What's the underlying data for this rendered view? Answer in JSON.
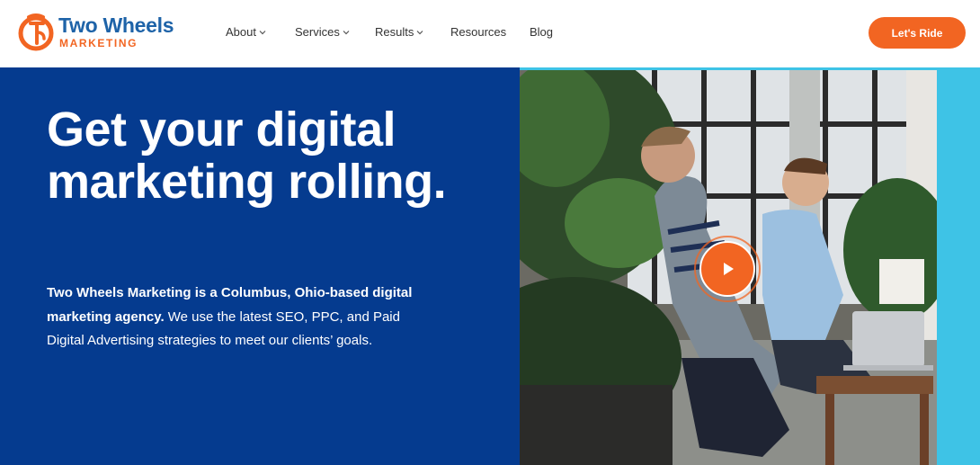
{
  "brand": {
    "name": "Two Wheels",
    "tagline": "MARKETING",
    "primary_color": "#1e63a8",
    "accent_color": "#f26522"
  },
  "nav": {
    "items": [
      {
        "label": "About",
        "has_dropdown": true
      },
      {
        "label": "Services",
        "has_dropdown": true
      },
      {
        "label": "Results",
        "has_dropdown": true
      },
      {
        "label": "Resources",
        "has_dropdown": false
      },
      {
        "label": "Blog",
        "has_dropdown": false
      }
    ],
    "cta_label": "Let's Ride"
  },
  "hero": {
    "headline": "Get your digital marketing rolling.",
    "description_bold": "Two Wheels Marketing is a Columbus, Ohio-based digital marketing agency.",
    "description_rest": " We use the latest SEO, PPC, and Paid Digital Advertising strategies to meet our clients’ goals.",
    "background_color": "#053b8f",
    "accent_panel_color": "#3ec3e6"
  },
  "video": {
    "play_icon": "play-icon"
  }
}
